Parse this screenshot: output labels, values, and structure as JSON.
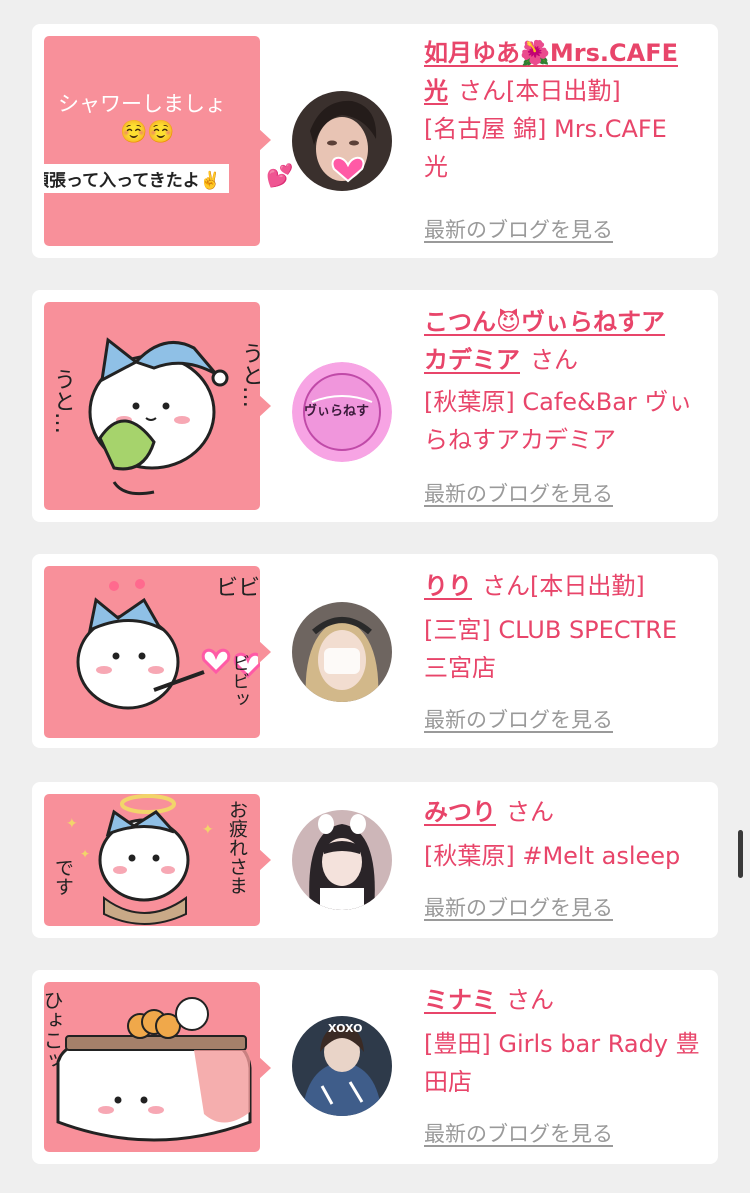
{
  "blog_list": [
    {
      "name_part1": "如月ゆあ🌺Mrs.CAFE",
      "name_part2": "光",
      "honorific": "さん",
      "status": "[本日出勤]",
      "area_line1": "[名古屋 錦] Mrs.CAFE",
      "area_line2": "光",
      "blog_link": "最新のブログを見る",
      "thumb_text1": "シャワーしましょ",
      "thumb_text2": "☺️☺️",
      "thumb_text3": "頑張って入ってきたよ✌️",
      "thumb_emoji": "💕"
    },
    {
      "name_part1": "こつん😈ヴぃらねすア",
      "name_part2": "カデミア",
      "honorific": "さん",
      "status": "",
      "area_line1": "[秋葉原] Cafe&Bar ヴぃ",
      "area_line2": "らねすアカデミア",
      "blog_link": "最新のブログを見る",
      "thumb_text1": "うと…",
      "thumb_text2": "うと…",
      "avatar_text": "ヴぃらねす"
    },
    {
      "name": "りり",
      "honorific": "さん",
      "status": "[本日出勤]",
      "area_line1": "[三宮] CLUB SPECTRE",
      "area_line2": "三宮店",
      "blog_link": "最新のブログを見る",
      "thumb_text1": "ビビ",
      "thumb_text2": "ビビッ"
    },
    {
      "name": "みつり",
      "honorific": "さん",
      "status": "",
      "area_line1": "[秋葉原] #Melt asleep",
      "blog_link": "最新のブログを見る",
      "thumb_text1": "お疲れさま",
      "thumb_text2": "です"
    },
    {
      "name": "ミナミ",
      "honorific": "さん",
      "status": "",
      "area_line1": "[豊田] Girls bar Rady 豊",
      "area_line2": "田店",
      "blog_link": "最新のブログを見る",
      "thumb_text1": "ひょこッ",
      "avatar_text": "XOXO"
    }
  ],
  "colors": {
    "accent": "#e8456a",
    "thumb_bg": "#f8909a",
    "link_gray": "#9a9a9a",
    "page_bg": "#efefef"
  }
}
